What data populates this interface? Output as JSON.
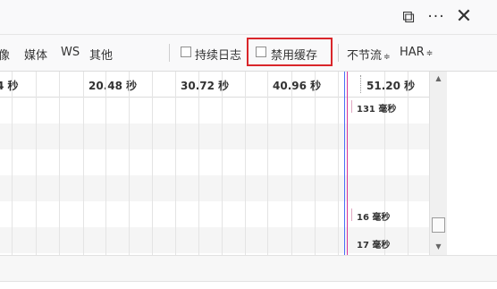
{
  "window": {
    "dock_label": "⧉",
    "more_label": "···",
    "close_label": "✕"
  },
  "toolbar": {
    "filters": [
      "像",
      "媒体",
      "WS",
      "其他"
    ],
    "persist_logs": {
      "label": "持续日志",
      "checked": false
    },
    "disable_cache": {
      "label": "禁用缓存",
      "checked": false
    },
    "throttle": {
      "label": "不节流",
      "caret": "≑"
    },
    "har": {
      "label": "HAR",
      "caret": "≑"
    },
    "highlight_color": "#d9262a"
  },
  "timeline": {
    "ticks": [
      "4 秒",
      "20.48 秒",
      "30.72 秒",
      "40.96 秒",
      "51.20 秒"
    ]
  },
  "waterfall": {
    "labels": [
      "131 毫秒",
      "16 毫秒",
      "17 毫秒"
    ],
    "markers": {
      "dom_content_loaded": "#4a6cf7",
      "load": "#d9379a"
    }
  },
  "scrollbar": {
    "up_arrow": "▲",
    "down_arrow": "▼"
  }
}
